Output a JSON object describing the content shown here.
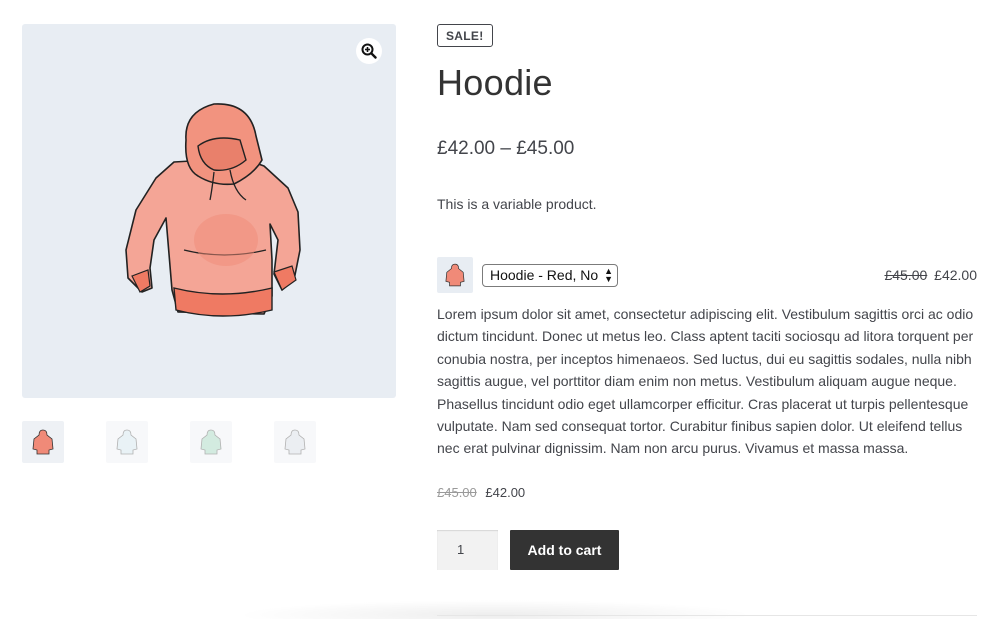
{
  "product": {
    "sale_badge": "SALE!",
    "title": "Hoodie",
    "price_range": "£42.00 – £45.00",
    "short_description": "This is a variable product.",
    "variation": {
      "selected": "Hoodie - Red, No",
      "regular_price": "£45.00",
      "sale_price": "£42.00"
    },
    "long_description": "Lorem ipsum dolor sit amet, consectetur adipiscing elit. Vestibulum sagittis orci ac odio dictum tincidunt. Donec ut metus leo. Class aptent taciti sociosqu ad litora torquent per conubia nostra, per inceptos himenaeos. Sed luctus, dui eu sagittis sodales, nulla nibh sagittis augue, vel porttitor diam enim non metus. Vestibulum aliquam augue neque. Phasellus tincidunt odio eget ullamcorper efficitur. Cras placerat ut turpis pellentesque vulputate. Nam sed consequat tortor. Curabitur finibus sapien dolor. Ut eleifend tellus nec erat pulvinar dignissim. Nam non arcu purus. Vivamus et massa massa.",
    "final_price": {
      "regular": "£45.00",
      "sale": "£42.00"
    },
    "quantity": "1",
    "add_to_cart_label": "Add to cart"
  },
  "gallery": {
    "zoom_icon": "zoom-in-icon",
    "thumbnails": [
      {
        "icon": "hoodie-red",
        "color": "#f08a78"
      },
      {
        "icon": "hoodie-light-blue",
        "color": "#cfe3ec"
      },
      {
        "icon": "hoodie-green",
        "color": "#b7dccb"
      },
      {
        "icon": "hoodie-grey",
        "color": "#d5dbe3"
      }
    ]
  },
  "colors": {
    "background": "#ffffff",
    "image_background": "#e8edf3",
    "button": "#333333",
    "text": "#43454b",
    "hoodie_red": "#f08a78"
  }
}
